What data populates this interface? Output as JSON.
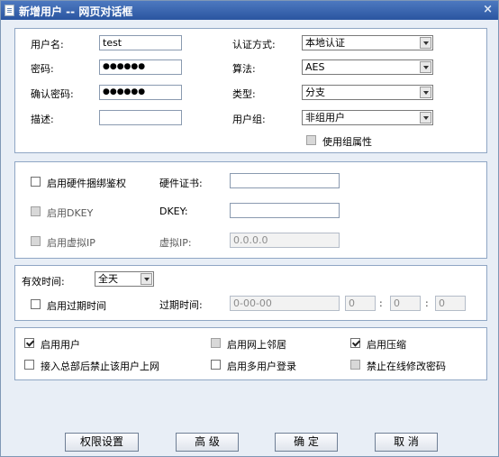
{
  "window": {
    "title": "新增用户 -- 网页对话框",
    "close": "×"
  },
  "account": {
    "username_label": "用户名:",
    "username_value": "test",
    "password_label": "密码:",
    "password_value": "●●●●●●",
    "confirm_label": "确认密码:",
    "confirm_value": "●●●●●●",
    "desc_label": "描述:",
    "desc_value": "",
    "auth_label": "认证方式:",
    "auth_value": "本地认证",
    "algo_label": "算法:",
    "algo_value": "AES",
    "type_label": "类型:",
    "type_value": "分支",
    "group_label": "用户组:",
    "group_value": "非组用户",
    "use_group_attr": "使用组属性",
    "use_group_attr_checked": false
  },
  "binding": {
    "hw_bind_label": "启用硬件捆绑鉴权",
    "hw_bind_checked": false,
    "hw_cert_label": "硬件证书:",
    "hw_cert_value": "",
    "dkey_enable_label": "启用DKEY",
    "dkey_enable_checked": false,
    "dkey_label": "DKEY:",
    "dkey_value": "",
    "vip_enable_label": "启用虚拟IP",
    "vip_enable_checked": false,
    "vip_label": "虚拟IP:",
    "vip_value": "0.0.0.0"
  },
  "validity": {
    "valid_label": "有效时间:",
    "valid_value": "全天",
    "expire_enable_label": "启用过期时间",
    "expire_enable_checked": false,
    "expire_label": "过期时间:",
    "expire_date": "0-00-00",
    "hour": "0",
    "minute": "0",
    "second": "0",
    "sep": ":"
  },
  "options": {
    "enable_user": "启用用户",
    "enable_user_checked": true,
    "network_neighbor": "启用网上邻居",
    "network_neighbor_checked": false,
    "compression": "启用压缩",
    "compression_checked": true,
    "ban_after_hq": "接入总部后禁止该用户上网",
    "ban_after_hq_checked": false,
    "multi_login": "启用多用户登录",
    "multi_login_checked": false,
    "no_online_pwd": "禁止在线修改密码",
    "no_online_pwd_checked": false
  },
  "buttons": {
    "permissions": "权限设置",
    "advanced": "高 级",
    "ok": "确 定",
    "cancel": "取 消"
  }
}
